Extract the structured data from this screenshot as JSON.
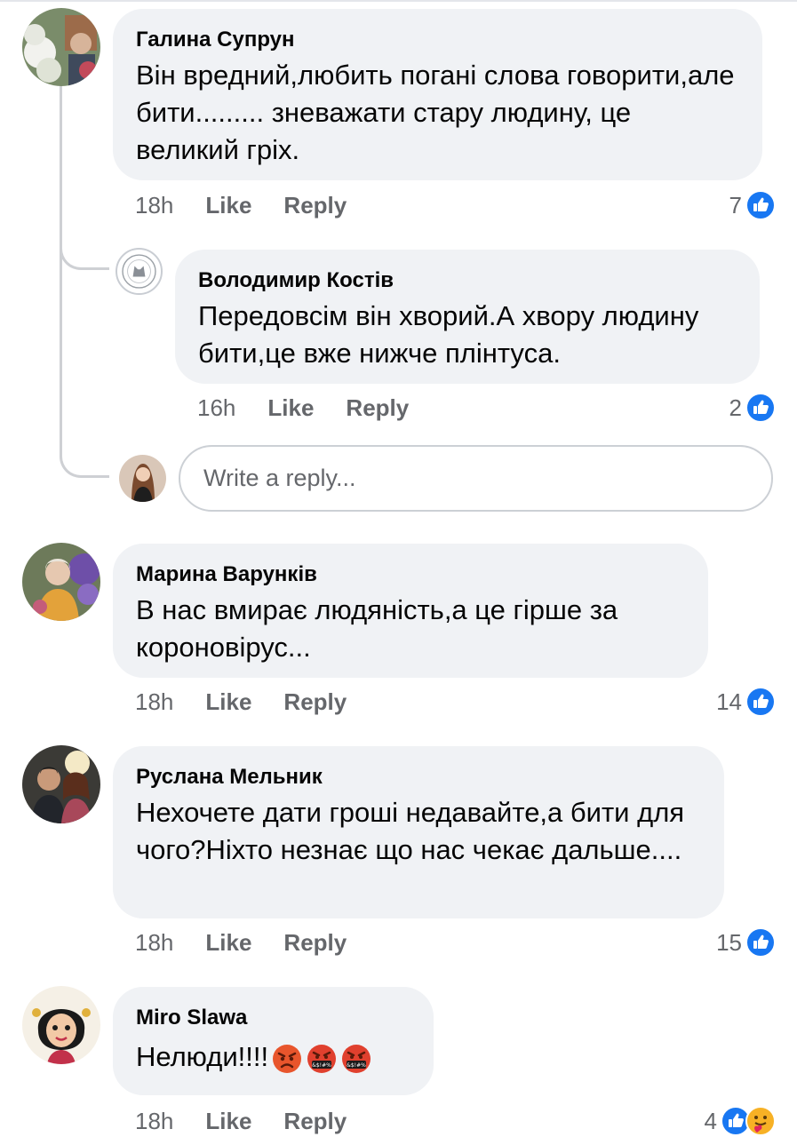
{
  "comments": [
    {
      "author": "Галина Супрун",
      "text": "Він вредний,любить погані слова говорити,але бити......... зневажати стару людину, це великий гріх.",
      "time": "18h",
      "like": "Like",
      "reply": "Reply",
      "reactions": "7"
    },
    {
      "author": "Володимир Костів",
      "text": "Передовсім він хворий.А хвору людину бити,це вже нижче плінтуса.",
      "time": "16h",
      "like": "Like",
      "reply": "Reply",
      "reactions": "2"
    },
    {
      "author": "Марина Варунків",
      "text": "В нас вмирає людяність,а це гірше за короновірус...",
      "time": "18h",
      "like": "Like",
      "reply": "Reply",
      "reactions": "14"
    },
    {
      "author": "Руслана Мельник",
      "text": "Нехочете дати гроші недавайте,а бити для чого?Ніхто незнає що нас чекає дальше....",
      "time": "18h",
      "like": "Like",
      "reply": "Reply",
      "reactions": "15"
    },
    {
      "author": "Miro Slawa",
      "text": "Нелюди!!!!",
      "emojis": [
        "angry-face-emoji",
        "cursing-face-emoji",
        "cursing-face-emoji"
      ],
      "time": "18h",
      "like": "Like",
      "reply": "Reply",
      "reactions": "4"
    }
  ],
  "reply_box": {
    "placeholder": "Write a reply..."
  },
  "icons": {
    "like_reaction": "like-reaction-icon",
    "care_reaction": "care-reaction-icon"
  },
  "colors": {
    "bubble_bg": "#f0f2f5",
    "meta_text": "#65676b",
    "like_blue": "#1877f2",
    "thread_line": "#ced0d4"
  }
}
